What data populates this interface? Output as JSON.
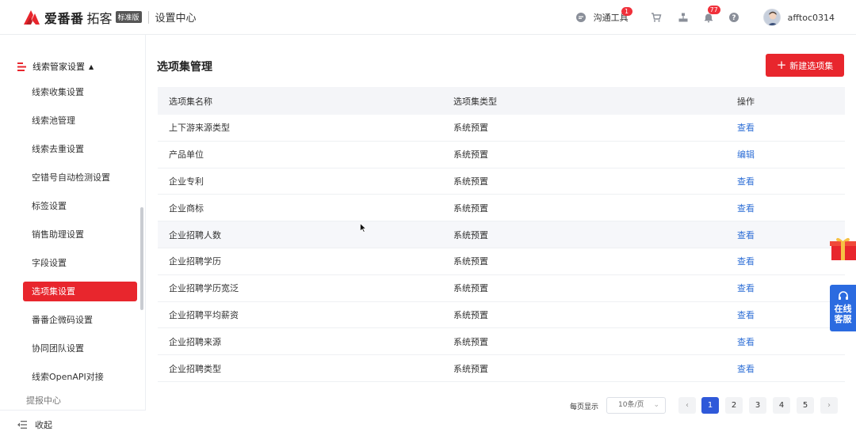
{
  "header": {
    "logo_name": "爱番番",
    "logo_sub": "拓客",
    "edition_badge": "标准版",
    "section_title": "设置中心",
    "tools_label": "沟通工具",
    "tools_badge": "1",
    "notification_badge": "77",
    "username": "afftoc0314"
  },
  "sidebar": {
    "group_label": "线索管家设置",
    "items": [
      {
        "label": "线索收集设置"
      },
      {
        "label": "线索池管理"
      },
      {
        "label": "线索去重设置"
      },
      {
        "label": "空错号自动检测设置"
      },
      {
        "label": "标签设置"
      },
      {
        "label": "销售助理设置"
      },
      {
        "label": "字段设置"
      },
      {
        "label": "选项集设置"
      },
      {
        "label": "番番企微码设置"
      },
      {
        "label": "协同团队设置"
      },
      {
        "label": "线索OpenAPI对接"
      }
    ],
    "active_index": 7,
    "partial_group_label": "提报中心",
    "collapse_label": "收起"
  },
  "main": {
    "title": "选项集管理",
    "new_button_label": "新建选项集",
    "columns": [
      "选项集名称",
      "选项集类型",
      "操作"
    ],
    "rows": [
      {
        "name": "上下游来源类型",
        "type": "系统预置",
        "action": "查看"
      },
      {
        "name": "产品单位",
        "type": "系统预置",
        "action": "编辑"
      },
      {
        "name": "企业专利",
        "type": "系统预置",
        "action": "查看"
      },
      {
        "name": "企业商标",
        "type": "系统预置",
        "action": "查看"
      },
      {
        "name": "企业招聘人数",
        "type": "系统预置",
        "action": "查看"
      },
      {
        "name": "企业招聘学历",
        "type": "系统预置",
        "action": "查看"
      },
      {
        "name": "企业招聘学历宽泛",
        "type": "系统预置",
        "action": "查看"
      },
      {
        "name": "企业招聘平均薪资",
        "type": "系统预置",
        "action": "查看"
      },
      {
        "name": "企业招聘来源",
        "type": "系统预置",
        "action": "查看"
      },
      {
        "name": "企业招聘类型",
        "type": "系统预置",
        "action": "查看"
      }
    ]
  },
  "pagination": {
    "per_page_label": "每页显示",
    "page_size": "10条/页",
    "pages": [
      "1",
      "2",
      "3",
      "4",
      "5"
    ],
    "current_page": "1",
    "prev_symbol": "‹",
    "next_symbol": "›"
  },
  "widgets": {
    "service_line1": "在线",
    "service_line2": "客服"
  },
  "colors": {
    "brand_red": "#e8262d",
    "link_blue": "#2f6fd6",
    "page_active": "#2f59d9",
    "service_blue": "#2b6be0"
  }
}
